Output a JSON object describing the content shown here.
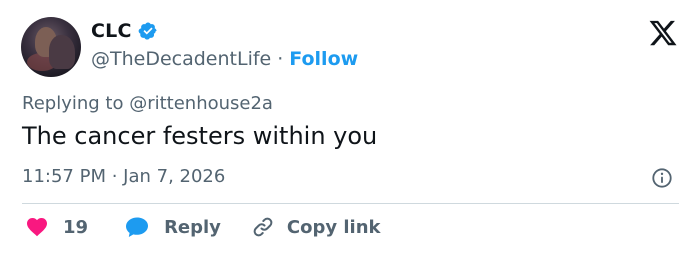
{
  "author": {
    "name": "CLC",
    "handle": "@TheDecadentLife",
    "separator": "·",
    "follow_label": "Follow"
  },
  "tweet": {
    "replying_to": "Replying to @rittenhouse2a",
    "text": "The cancer festers within you",
    "timestamp": "11:57 PM · Jan 7, 2026"
  },
  "actions": {
    "like_count": "19",
    "reply_label": "Reply",
    "copy_label": "Copy link"
  },
  "icons": {
    "verified": "verified-badge-icon",
    "brand": "x-logo-icon",
    "info": "info-icon",
    "like": "heart-icon",
    "reply": "speech-bubble-icon",
    "copy": "link-icon"
  },
  "colors": {
    "accent": "#1d9bf0",
    "like": "#f91880",
    "text": "#0f1419",
    "muted": "#536471",
    "divider": "#cfd9de"
  }
}
